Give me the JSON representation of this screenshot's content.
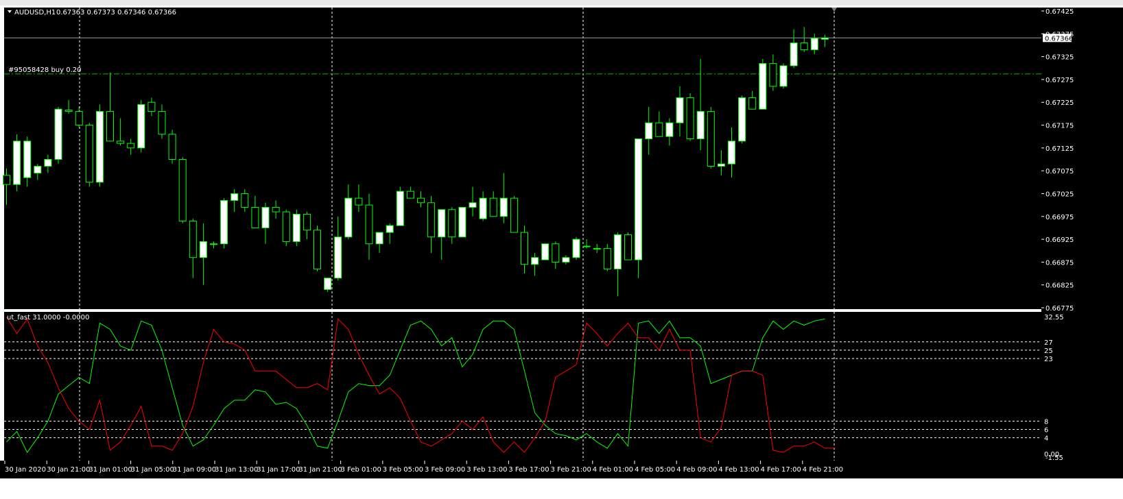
{
  "main_panel": {
    "symbol_label": "AUDUSD,H1",
    "ohlc_label": "0.67363 0.67373 0.67346 0.67366",
    "order_label": "#95058428 buy 0.20",
    "current_price_label": "0.67366",
    "order_price": 0.67287,
    "current_price": 0.67366
  },
  "sub_panel": {
    "indicator_label": "ut_fast 31.0000 -0.0000",
    "levels": [
      27,
      25,
      23,
      8,
      6,
      4
    ],
    "level_labels": [
      "27",
      "25",
      "23",
      "8",
      "6",
      "4"
    ],
    "top_label": "32.55",
    "bottom_label": "0.00",
    "bottom_label2": "-1.55"
  },
  "colors": {
    "background": "#000000",
    "bull_candle_body": "#ffffff",
    "candle_outline": "#00ff00",
    "green_line": "#00ff00",
    "red_line": "#ff0000",
    "grid": "#ffffff",
    "order_line": "#00c000"
  },
  "chart_data": [
    {
      "type": "candlestick",
      "title": "AUDUSD,H1",
      "ylim": [
        0.66775,
        0.67425
      ],
      "y_ticks": [
        0.67425,
        0.67375,
        0.67325,
        0.67275,
        0.67225,
        0.67175,
        0.67125,
        0.67075,
        0.67025,
        0.66975,
        0.66925,
        0.66875,
        0.66825,
        0.66775
      ],
      "y_tick_labels": [
        "0.67425",
        "0.67375",
        "0.67325",
        "0.67275",
        "0.67225",
        "0.67175",
        "0.67125",
        "0.67075",
        "0.67025",
        "0.66975",
        "0.66925",
        "0.66875",
        "0.66825",
        "0.66775"
      ],
      "ohlc": [
        [
          0.67065,
          0.6708,
          0.67,
          0.67045
        ],
        [
          0.67045,
          0.67155,
          0.6703,
          0.6714
        ],
        [
          0.6706,
          0.6715,
          0.6704,
          0.6714
        ],
        [
          0.6707,
          0.6709,
          0.67055,
          0.67085
        ],
        [
          0.67085,
          0.6711,
          0.6707,
          0.671
        ],
        [
          0.671,
          0.67215,
          0.6709,
          0.6721
        ],
        [
          0.67208,
          0.6723,
          0.672,
          0.67205
        ],
        [
          0.67205,
          0.67215,
          0.6717,
          0.67175
        ],
        [
          0.67175,
          0.6718,
          0.6704,
          0.6705
        ],
        [
          0.6705,
          0.6722,
          0.6704,
          0.67205
        ],
        [
          0.67205,
          0.6729,
          0.6714,
          0.6714
        ],
        [
          0.6714,
          0.6719,
          0.6713,
          0.67135
        ],
        [
          0.67135,
          0.67145,
          0.6711,
          0.67125
        ],
        [
          0.67125,
          0.6723,
          0.67115,
          0.6722
        ],
        [
          0.67225,
          0.67235,
          0.67195,
          0.67205
        ],
        [
          0.67205,
          0.6722,
          0.67145,
          0.67155
        ],
        [
          0.67155,
          0.67165,
          0.6709,
          0.671
        ],
        [
          0.671,
          0.67105,
          0.6696,
          0.66965
        ],
        [
          0.66965,
          0.6697,
          0.6684,
          0.66885
        ],
        [
          0.66885,
          0.6696,
          0.66825,
          0.6692
        ],
        [
          0.66915,
          0.6692,
          0.66905,
          0.66915
        ],
        [
          0.66915,
          0.67015,
          0.66905,
          0.6701
        ],
        [
          0.6701,
          0.67035,
          0.66985,
          0.67025
        ],
        [
          0.67025,
          0.67035,
          0.66985,
          0.66995
        ],
        [
          0.66995,
          0.6702,
          0.6695,
          0.6695
        ],
        [
          0.6695,
          0.67005,
          0.66915,
          0.66995
        ],
        [
          0.66995,
          0.6701,
          0.6697,
          0.66985
        ],
        [
          0.66985,
          0.6699,
          0.6691,
          0.6692
        ],
        [
          0.6692,
          0.6699,
          0.6691,
          0.6698
        ],
        [
          0.6698,
          0.66985,
          0.66925,
          0.66945
        ],
        [
          0.66945,
          0.66955,
          0.66855,
          0.6686
        ],
        [
          0.66815,
          0.6684,
          0.6681,
          0.6684
        ],
        [
          0.6684,
          0.66975,
          0.66835,
          0.6693
        ],
        [
          0.6693,
          0.67045,
          0.66925,
          0.67015
        ],
        [
          0.67015,
          0.67045,
          0.66985,
          0.67
        ],
        [
          0.67,
          0.67025,
          0.6688,
          0.66915
        ],
        [
          0.66915,
          0.6694,
          0.66895,
          0.6694
        ],
        [
          0.6694,
          0.6696,
          0.66915,
          0.66955
        ],
        [
          0.66955,
          0.6704,
          0.66955,
          0.6703
        ],
        [
          0.6703,
          0.6704,
          0.67015,
          0.67015
        ],
        [
          0.67015,
          0.6703,
          0.66995,
          0.67005
        ],
        [
          0.67005,
          0.6702,
          0.66895,
          0.6693
        ],
        [
          0.6693,
          0.6699,
          0.6688,
          0.6699
        ],
        [
          0.6699,
          0.66995,
          0.66915,
          0.6693
        ],
        [
          0.6693,
          0.66995,
          0.6693,
          0.66995
        ],
        [
          0.66995,
          0.6704,
          0.66975,
          0.67005
        ],
        [
          0.6697,
          0.6703,
          0.66965,
          0.67015
        ],
        [
          0.67015,
          0.6703,
          0.66975,
          0.66975
        ],
        [
          0.66975,
          0.6707,
          0.6696,
          0.67015
        ],
        [
          0.67015,
          0.6702,
          0.6694,
          0.6694
        ],
        [
          0.6694,
          0.66955,
          0.6685,
          0.6687
        ],
        [
          0.6687,
          0.66895,
          0.66845,
          0.66885
        ],
        [
          0.6688,
          0.66915,
          0.6688,
          0.66915
        ],
        [
          0.66915,
          0.6692,
          0.6686,
          0.66875
        ],
        [
          0.66875,
          0.6689,
          0.6687,
          0.66885
        ],
        [
          0.66885,
          0.6693,
          0.6688,
          0.66925
        ],
        [
          0.6691,
          0.66925,
          0.66905,
          0.6691
        ],
        [
          0.66905,
          0.66915,
          0.66895,
          0.66905
        ],
        [
          0.66905,
          0.66915,
          0.66855,
          0.6686
        ],
        [
          0.6686,
          0.6694,
          0.668,
          0.66935
        ],
        [
          0.66935,
          0.6694,
          0.6688,
          0.6688
        ],
        [
          0.6688,
          0.6696,
          0.6684,
          0.67145
        ],
        [
          0.67145,
          0.67215,
          0.6711,
          0.6718
        ],
        [
          0.6718,
          0.67205,
          0.6715,
          0.6715
        ],
        [
          0.6715,
          0.6719,
          0.6713,
          0.6718
        ],
        [
          0.6718,
          0.6726,
          0.6715,
          0.67235
        ],
        [
          0.67235,
          0.67245,
          0.6714,
          0.67145
        ],
        [
          0.67145,
          0.6732,
          0.6712,
          0.67205
        ],
        [
          0.67205,
          0.67215,
          0.6708,
          0.67085
        ],
        [
          0.67085,
          0.6712,
          0.67065,
          0.6709
        ],
        [
          0.6709,
          0.6717,
          0.6706,
          0.6714
        ],
        [
          0.6714,
          0.6724,
          0.67135,
          0.67235
        ],
        [
          0.67235,
          0.6725,
          0.6721,
          0.6721
        ],
        [
          0.6721,
          0.6732,
          0.6721,
          0.6731
        ],
        [
          0.6731,
          0.6733,
          0.6725,
          0.6726
        ],
        [
          0.6726,
          0.6731,
          0.67255,
          0.67305
        ],
        [
          0.67305,
          0.67385,
          0.673,
          0.67355
        ],
        [
          0.67355,
          0.6739,
          0.67335,
          0.6734
        ],
        [
          0.6734,
          0.67375,
          0.6733,
          0.67365
        ],
        [
          0.67363,
          0.67373,
          0.67346,
          0.67366
        ]
      ]
    },
    {
      "type": "line",
      "title": "ut_fast 31.0000 -0.0000",
      "ylim": [
        0,
        32.55
      ],
      "x_tick_labels": [
        "30 Jan 2020",
        "30 Jan 21:00",
        "31 Jan 01:00",
        "31 Jan 05:00",
        "31 Jan 09:00",
        "31 Jan 13:00",
        "31 Jan 17:00",
        "31 Jan 21:00",
        "3 Feb 01:00",
        "3 Feb 05:00",
        "3 Feb 09:00",
        "3 Feb 13:00",
        "3 Feb 17:00",
        "3 Feb 21:00",
        "4 Feb 01:00",
        "4 Feb 05:00",
        "4 Feb 09:00",
        "4 Feb 13:00",
        "4 Feb 17:00",
        "4 Feb 21:00"
      ],
      "series": [
        {
          "color": "#00ff00",
          "values": [
            3,
            5.5,
            0.5,
            4,
            8,
            14.5,
            16.5,
            18.5,
            17,
            31.5,
            30,
            26,
            25,
            32,
            31,
            25,
            16,
            7,
            2,
            3.5,
            7,
            11,
            13,
            13,
            15.5,
            15,
            12,
            12.5,
            11,
            7,
            2,
            1.5,
            8,
            15,
            17,
            16.5,
            16.5,
            19,
            25,
            31,
            32,
            30,
            26,
            28,
            21,
            24,
            30,
            32,
            32,
            30,
            20,
            10,
            7,
            5,
            4.5,
            3.5,
            5,
            3,
            1.5,
            5,
            2,
            31.5,
            32,
            29,
            32,
            28,
            28,
            26,
            17,
            18,
            19,
            20,
            20,
            28,
            32,
            30,
            32,
            31,
            32,
            32.5
          ]
        },
        {
          "color": "#ff0000",
          "values": [
            33,
            29,
            32.5,
            26,
            22,
            16,
            11,
            8,
            6,
            13,
            1,
            3,
            7,
            11.5,
            2,
            2,
            1,
            5,
            11.5,
            22,
            30,
            27,
            26.5,
            25,
            20,
            20,
            20,
            18,
            16,
            16,
            17,
            15.5,
            32.5,
            30,
            24,
            19,
            14.5,
            16,
            13.5,
            8,
            3,
            2,
            3.5,
            5,
            8,
            6,
            9,
            3,
            0.5,
            3,
            0.5,
            4,
            8,
            18.5,
            20,
            21.5,
            31.5,
            29,
            26,
            29,
            31.5,
            28,
            28,
            25,
            30,
            25,
            25,
            4,
            3,
            6.5,
            19,
            20,
            20,
            19,
            1,
            0.5,
            2,
            2,
            3,
            1.5,
            1.5
          ]
        }
      ]
    }
  ]
}
